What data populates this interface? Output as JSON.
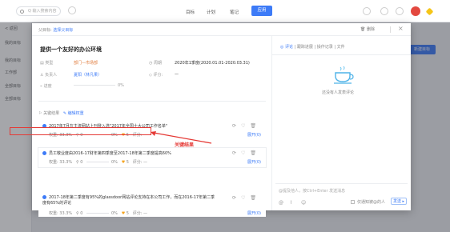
{
  "topbar": {
    "search_placeholder": "Q 输入搜索内容",
    "nav": [
      "目标",
      "计划",
      "笔记"
    ],
    "nav_active": "应用"
  },
  "sidebar": {
    "back": "< 返回",
    "items": [
      "我的目标",
      "我的目标",
      "工作部",
      "全部目标",
      "全部目标"
    ]
  },
  "background": {
    "new_goal": "新建目标"
  },
  "modal": {
    "parent_label": "父目标:",
    "parent_link": "选择父目标",
    "delete": "删除",
    "close": "×",
    "title": "提供一个友好的办公环境",
    "fields": {
      "type_label": "类型",
      "type_value": "部门—市场部",
      "period_label": "周期",
      "period_value": "2020年1季度(2020.01.01-2020.03.31)",
      "owner_label": "负责人",
      "owner_value": "夏阳（林凡果）",
      "score_label": "评分:",
      "score_value": "—",
      "progress_label": "进度",
      "progress_value": "0%"
    },
    "kr_header": "关键结果",
    "kr_edit": "编辑权重",
    "key_results": [
      {
        "title": "2017年7月在主流网站上刊登入选\"2017年全国十大公司工作名单\"",
        "weight": "权重: 33.3%",
        "tasks": "0",
        "progress": "0%",
        "likes": "5",
        "score": "评分: —",
        "expand": "展开(0)"
      },
      {
        "title": "员工敬业度由2016-17财年第四季度至2017-18年第二季度提高60%",
        "weight": "权重: 33.3%",
        "tasks": "0",
        "progress": "0%",
        "likes": "5",
        "score": "评分: —",
        "expand": "展开(0)"
      },
      {
        "title": "2017-18年第二季度有95%的glassdoor网站评论支持在本公司工作，而在2016-17年第二季度有65%的评论",
        "weight": "权重: 33.3%",
        "tasks": "0",
        "progress": "0%",
        "likes": "5",
        "score": "评分: —",
        "expand": "展开(0)"
      }
    ],
    "callout": "关键结果",
    "right": {
      "tabs": [
        "评论",
        "跟踪进展",
        "操作记录",
        "文件"
      ],
      "empty": "还没有人发表评论",
      "comment_placeholder": "@提及他人，按Ctrl+Enter 发送消息",
      "notify_label": "仅通知被@的人",
      "send": "发送"
    }
  },
  "colors": {
    "accent": "#3d7bf7",
    "callout": "#e53935",
    "type": "#e07b3c"
  }
}
